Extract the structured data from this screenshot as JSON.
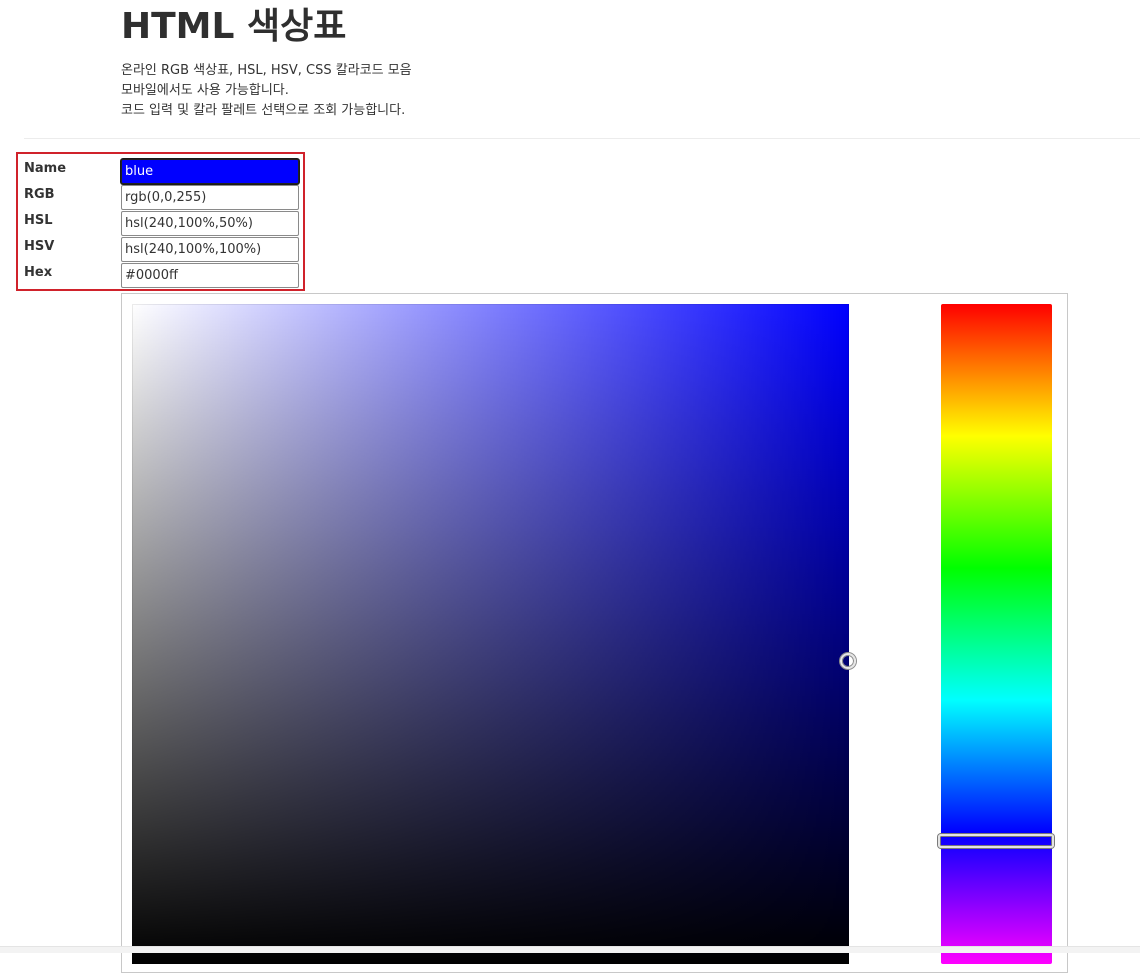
{
  "header": {
    "title": "HTML 색상표",
    "description": [
      "온라인 RGB 색상표, HSL, HSV, CSS 칼라코드 모음",
      "모바일에서도 사용 가능합니다.",
      "코드 입력 및 칼라 팔레트 선택으로 조회 가능합니다."
    ]
  },
  "codes": {
    "name": {
      "label": "Name",
      "value": "blue"
    },
    "rgb": {
      "label": "RGB",
      "value": "rgb(0,0,255)"
    },
    "hsl": {
      "label": "HSL",
      "value": "hsl(240,100%,50%)"
    },
    "hsv": {
      "label": "HSV",
      "value": "hsl(240,100%,100%)"
    },
    "hex": {
      "label": "Hex",
      "value": "#0000ff"
    }
  },
  "colors": {
    "selected": "#0000ff",
    "highlight_border": "#d0222b"
  },
  "picker": {
    "hue": 240,
    "saturation": 100,
    "value": 100
  }
}
